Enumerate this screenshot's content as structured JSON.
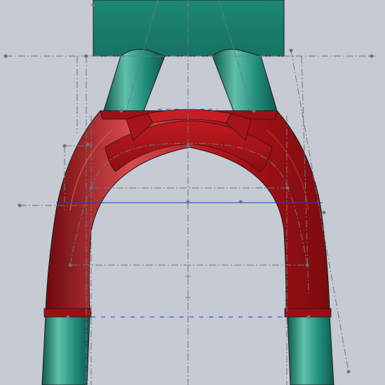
{
  "viewport": {
    "background_color": "#c5cad3",
    "view_label": ""
  },
  "colors": {
    "teal_body": "#1f8a78",
    "teal_dark": "#0f5a4d",
    "teal_highlight": "#5fc0ab",
    "red_body": "#b4151a",
    "red_dark": "#6c0a0d",
    "red_highlight": "#d94b4d",
    "construction_line": "#707780",
    "sketch_blue": "#1c3adf",
    "outline": "#1a1a1a"
  },
  "parts": {
    "top_block": "top-block",
    "upper_tubes": "upper-tubes",
    "arch_yoke": "red-arch-yoke",
    "lower_legs": "lower-legs"
  },
  "icons": {
    "origin_marker": "plus-marker-icon",
    "sketch_point": "sketch-point-icon"
  }
}
